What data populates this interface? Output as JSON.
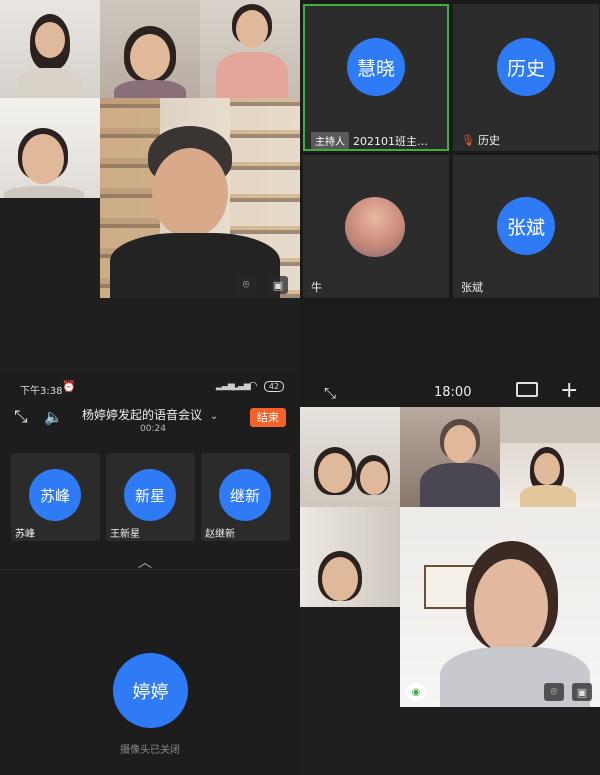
{
  "top_right": {
    "tiles": [
      {
        "avatar": "慧晓",
        "label": "202101班主…",
        "host_tag": "主持人"
      },
      {
        "avatar": "历史",
        "label": "历史",
        "label_icon": "mic-muted-icon"
      },
      {
        "avatar": "",
        "label": "牛"
      },
      {
        "avatar": "张斌",
        "label": "张斌"
      }
    ]
  },
  "phone_call": {
    "status_time": "下午3:38",
    "battery": "42",
    "title": "杨婷婷发起的语音会议",
    "duration": "00:24",
    "end_button": "结束",
    "participants": [
      {
        "avatar": "苏峰",
        "name": "苏峰"
      },
      {
        "avatar": "新星",
        "name": "王新星"
      },
      {
        "avatar": "继新",
        "name": "赵继新"
      }
    ],
    "self_avatar": "婷婷",
    "camera_status": "摄像头已关闭"
  },
  "bottom_right": {
    "time": "18:00"
  },
  "colors": {
    "accent_blue": "#2f7bf5",
    "active_border": "#3fae3f",
    "end_button": "#f4622a",
    "background": "#1b1b1b"
  }
}
